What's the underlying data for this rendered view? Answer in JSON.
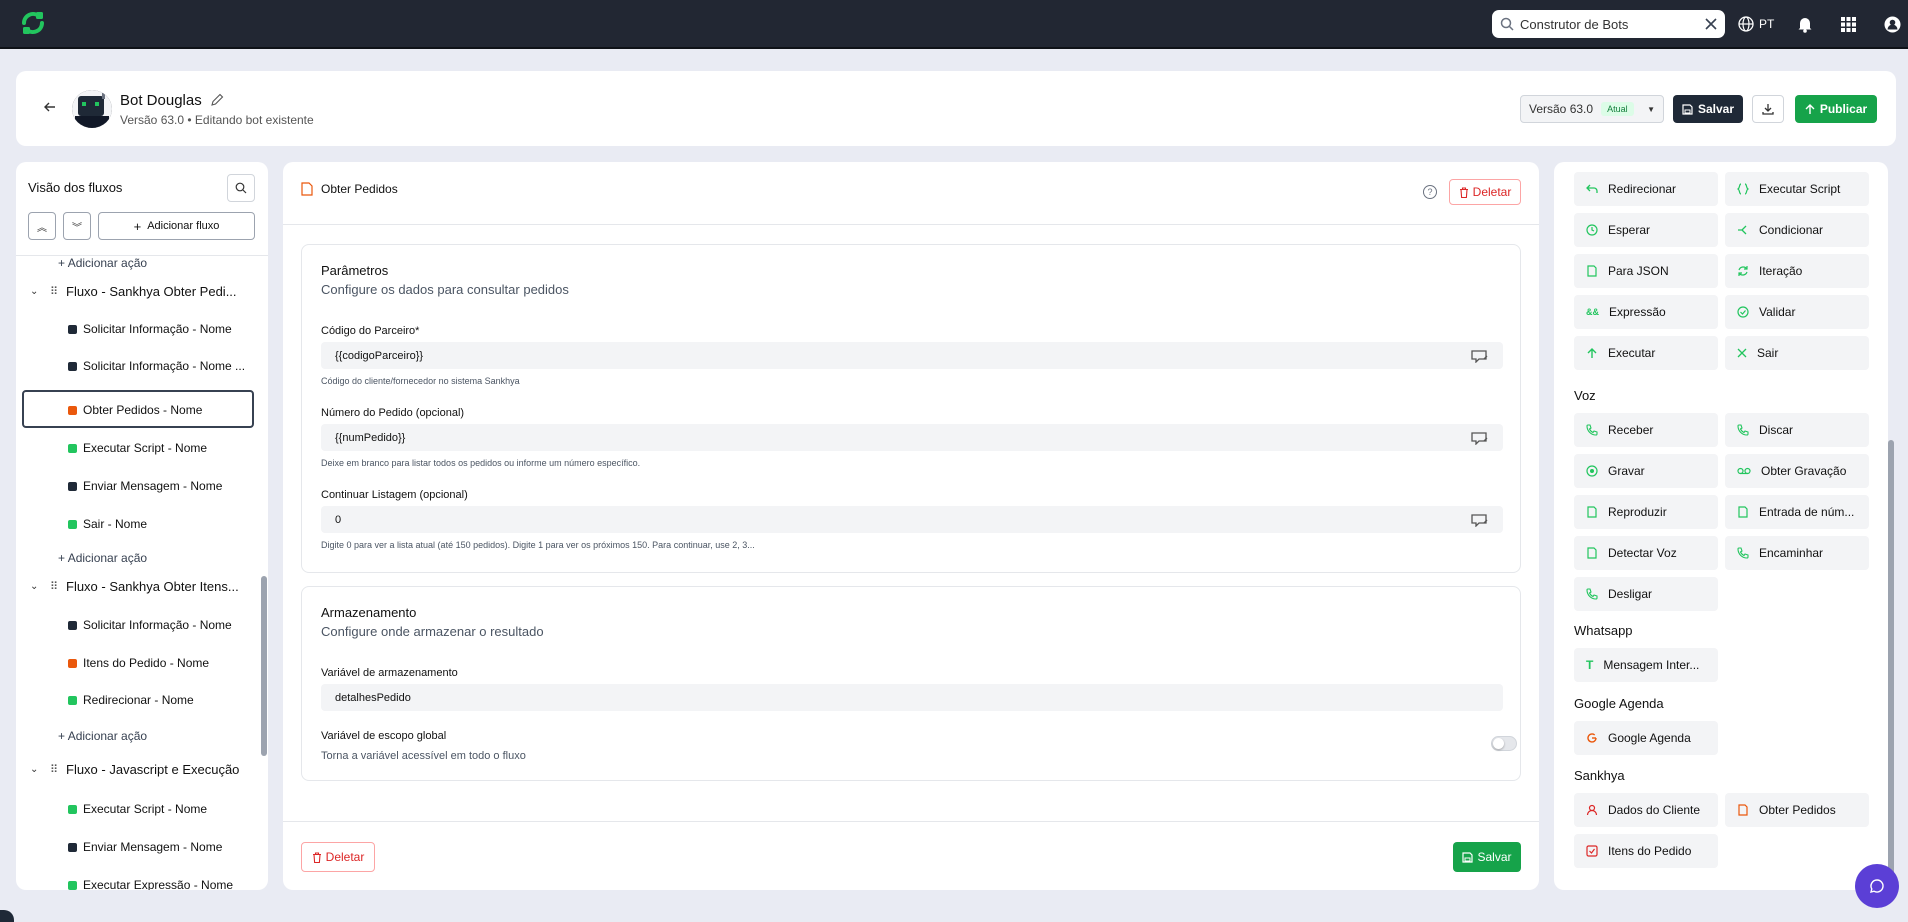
{
  "topbar": {
    "search_value": "Construtor de Bots",
    "lang": "PT",
    "icons": [
      "logo-icon",
      "search-icon",
      "clear-icon",
      "globe-icon",
      "bell-icon",
      "apps-grid-icon",
      "user-icon"
    ]
  },
  "header": {
    "bot_name": "Bot Douglas",
    "subtitle": "Versão 63.0 • Editando bot existente",
    "version_label": "Versão 63.0",
    "version_badge": "Atual",
    "save_label": "Salvar",
    "publish_label": "Publicar"
  },
  "left": {
    "title": "Visão dos fluxos",
    "add_flow": "Adicionar fluxo",
    "add_action": "Adicionar ação",
    "flows": [
      {
        "name": "Fluxo - Sankhya Obter Pedi...",
        "items": [
          {
            "label": "Solicitar Informação - Nome",
            "color": "#1f2937"
          },
          {
            "label": "Solicitar Informação - Nome ...",
            "color": "#1f2937"
          },
          {
            "label": "Obter Pedidos - Nome",
            "color": "#ea580c"
          },
          {
            "label": "Executar Script - Nome",
            "color": "#22c55e"
          },
          {
            "label": "Enviar Mensagem - Nome",
            "color": "#1f2937"
          },
          {
            "label": "Sair - Nome",
            "color": "#22c55e"
          }
        ]
      },
      {
        "name": "Fluxo - Sankhya Obter Itens...",
        "items": [
          {
            "label": "Solicitar Informação - Nome",
            "color": "#1f2937"
          },
          {
            "label": "Itens do Pedido - Nome",
            "color": "#ea580c"
          },
          {
            "label": "Redirecionar - Nome",
            "color": "#22c55e"
          }
        ]
      },
      {
        "name": "Fluxo - Javascript e Execução",
        "items": [
          {
            "label": "Executar Script - Nome",
            "color": "#22c55e"
          },
          {
            "label": "Enviar Mensagem - Nome",
            "color": "#1f2937"
          },
          {
            "label": "Executar Expressão - Nome",
            "color": "#22c55e"
          }
        ]
      }
    ]
  },
  "center": {
    "title": "Obter Pedidos",
    "delete_label": "Deletar",
    "save_label": "Salvar",
    "params": {
      "title": "Parâmetros",
      "subtitle": "Configure os dados para consultar pedidos",
      "fields": [
        {
          "label": "Código do Parceiro*",
          "value": "{{codigoParceiro}}",
          "help": "Código do cliente/fornecedor no sistema Sankhya"
        },
        {
          "label": "Número do Pedido (opcional)",
          "value": "{{numPedido}}",
          "help": "Deixe em branco para listar todos os pedidos ou informe um número específico."
        },
        {
          "label": "Continuar Listagem (opcional)",
          "value": "0",
          "help": "Digite 0 para ver a lista atual (até 150 pedidos). Digite 1 para ver os próximos 150. Para continuar, use 2, 3..."
        }
      ]
    },
    "storage": {
      "title": "Armazenamento",
      "subtitle": "Configure onde armazenar o resultado",
      "var_label": "Variável de armazenamento",
      "var_value": "detalhesPedido",
      "global_label": "Variável de escopo global",
      "global_help": "Torna a variável acessível em todo o fluxo",
      "global_on": false
    }
  },
  "right": {
    "general": [
      "Redirecionar",
      "Executar Script",
      "Esperar",
      "Condicionar",
      "Para JSON",
      "Iteração",
      "Expressão",
      "Validar",
      "Executar",
      "Sair"
    ],
    "voz_title": "Voz",
    "voz": [
      "Receber",
      "Discar",
      "Gravar",
      "Obter Gravação",
      "Reproduzir",
      "Entrada de núm...",
      "Detectar Voz",
      "Encaminhar",
      "Desligar"
    ],
    "whatsapp_title": "Whatsapp",
    "whatsapp": [
      "Mensagem Inter..."
    ],
    "gagenda_title": "Google Agenda",
    "gagenda": [
      "Google Agenda"
    ],
    "sankhya_title": "Sankhya",
    "sankhya": [
      "Dados do Cliente",
      "Obter Pedidos",
      "Itens do Pedido"
    ],
    "colors": {
      "green": "#22c55e",
      "orange": "#ea580c",
      "red": "#dc2626"
    }
  }
}
